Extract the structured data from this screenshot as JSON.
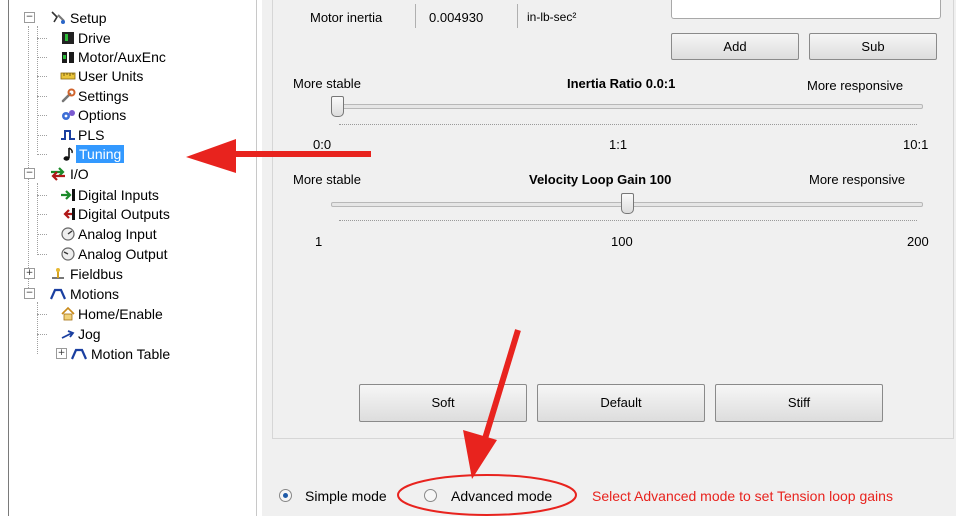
{
  "tree": {
    "items": [
      {
        "label": "Setup",
        "icon": "setup-icon",
        "expander": "−"
      },
      {
        "label": "Drive",
        "icon": "drive-icon"
      },
      {
        "label": "Motor/AuxEnc",
        "icon": "motor-icon"
      },
      {
        "label": "User Units",
        "icon": "ruler-icon"
      },
      {
        "label": "Settings",
        "icon": "wrench-icon"
      },
      {
        "label": "Options",
        "icon": "options-icon"
      },
      {
        "label": "PLS",
        "icon": "pulse-icon"
      },
      {
        "label": "Tuning",
        "icon": "music-note-icon",
        "selected": true
      },
      {
        "label": "I/O",
        "icon": "io-arrows-icon",
        "expander": "−"
      },
      {
        "label": "Digital Inputs",
        "icon": "digital-input-icon"
      },
      {
        "label": "Digital Outputs",
        "icon": "digital-output-icon"
      },
      {
        "label": "Analog Input",
        "icon": "gauge-icon"
      },
      {
        "label": "Analog Output",
        "icon": "gauge-icon"
      },
      {
        "label": "Fieldbus",
        "icon": "fieldbus-icon",
        "expander": "+"
      },
      {
        "label": "Motions",
        "icon": "motion-icon",
        "expander": "−"
      },
      {
        "label": "Home/Enable",
        "icon": "home-icon"
      },
      {
        "label": "Jog",
        "icon": "jog-arrow-icon"
      },
      {
        "label": "Motion Table",
        "icon": "motion-icon",
        "expander": "+"
      }
    ]
  },
  "inertia": {
    "label": "Motor inertia",
    "value": "0.004930",
    "unit": "in-lb-sec²",
    "add_label": "Add",
    "sub_label": "Sub"
  },
  "inertia_ratio": {
    "left_label": "More stable",
    "title": "Inertia Ratio  0.0:1",
    "right_label": "More responsive",
    "min_label": "0:0",
    "mid_label": "1:1",
    "max_label": "10:1",
    "level": 0.0
  },
  "velocity_gain": {
    "left_label": "More stable",
    "title": "Velocity Loop Gain  100",
    "right_label": "More responsive",
    "min_label": "1",
    "mid_label": "100",
    "max_label": "200",
    "level": 0.5
  },
  "presets": {
    "soft_label": "Soft",
    "default_label": "Default",
    "stiff_label": "Stiff"
  },
  "mode": {
    "simple_label": "Simple mode",
    "advanced_label": "Advanced mode",
    "selected": "simple",
    "hint": "Select Advanced mode to set Tension loop gains"
  },
  "colors": {
    "annotation_red": "#e8231e",
    "selection_blue": "#3399ff"
  }
}
